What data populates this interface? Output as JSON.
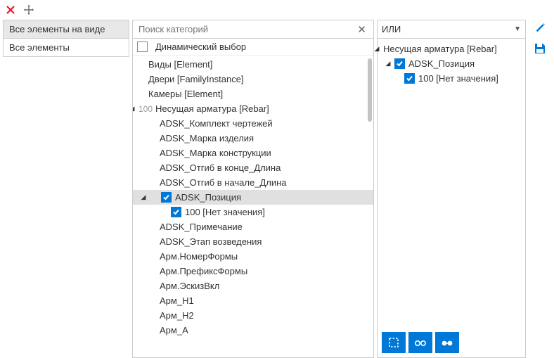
{
  "left": {
    "items": [
      {
        "label": "Все элементы на виде",
        "selected": true
      },
      {
        "label": "Все элементы",
        "selected": false
      }
    ]
  },
  "search": {
    "placeholder": "Поиск категорий"
  },
  "dynamic": {
    "label": "Динамический выбор",
    "checked": false
  },
  "tree": [
    {
      "indent": 1,
      "label": "Виды [Element]"
    },
    {
      "indent": 1,
      "label": "Двери [FamilyInstance]"
    },
    {
      "indent": 1,
      "label": "Камеры [Element]"
    },
    {
      "indent": 0,
      "label": "Несущая арматура [Rebar]",
      "count": "100",
      "expander": "down"
    },
    {
      "indent": 2,
      "label": "ADSK_Комплект чертежей"
    },
    {
      "indent": 2,
      "label": "ADSK_Марка изделия"
    },
    {
      "indent": 2,
      "label": "ADSK_Марка конструкции"
    },
    {
      "indent": 2,
      "label": "ADSK_Отгиб в конце_Длина"
    },
    {
      "indent": 2,
      "label": "ADSK_Отгиб в начале_Длина"
    },
    {
      "indent": 2,
      "label": "ADSK_Позиция",
      "checkbox": true,
      "checked": true,
      "expander": "down",
      "expIndent": 1,
      "selected": true
    },
    {
      "indent": 3,
      "label": "100 [Нет значения]",
      "checkbox": true,
      "checked": true
    },
    {
      "indent": 2,
      "label": "ADSK_Примечание"
    },
    {
      "indent": 2,
      "label": "ADSK_Этап возведения"
    },
    {
      "indent": 2,
      "label": "Арм.НомерФормы"
    },
    {
      "indent": 2,
      "label": "Арм.ПрефиксФормы"
    },
    {
      "indent": 2,
      "label": "Арм.ЭскизВкл"
    },
    {
      "indent": 2,
      "label": "Арм_H1"
    },
    {
      "indent": 2,
      "label": "Арм_H2"
    },
    {
      "indent": 2,
      "label": "Арм_A"
    }
  ],
  "right": {
    "dropdown": "ИЛИ",
    "tree": [
      {
        "indent": 0,
        "label": "Несущая арматура [Rebar]",
        "expander": "down"
      },
      {
        "indent": 1,
        "label": "ADSK_Позиция",
        "checkbox": true,
        "checked": true,
        "expander": "down"
      },
      {
        "indent": 2,
        "label": "100 [Нет значения]",
        "checkbox": true,
        "checked": true
      }
    ]
  },
  "colors": {
    "accent": "#0078d7",
    "close": "#e81123"
  }
}
